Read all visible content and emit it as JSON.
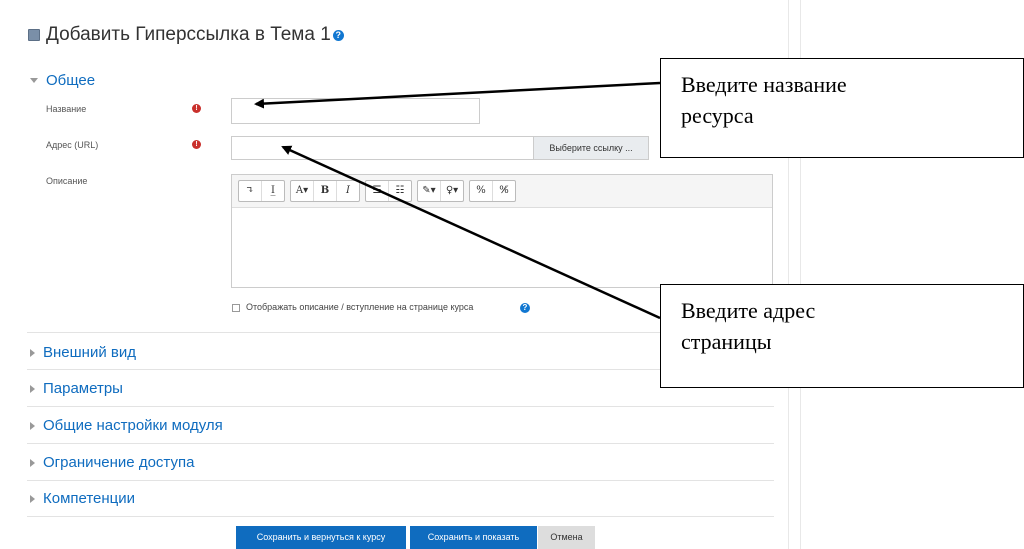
{
  "page": {
    "title": "Добавить Гиперссылка в Тема 1",
    "help_glyph": "?"
  },
  "general_section": {
    "title": "Общее",
    "name_label": "Название",
    "name_value": "",
    "url_label": "Адрес (URL)",
    "url_value": "",
    "choose_link_label": "Выберите ссылку ...",
    "description_label": "Описание",
    "required_glyph": "!",
    "toolbar": {
      "undo": "↴",
      "clear": "I̲",
      "font": "A▾",
      "bold": "B",
      "italic": "I",
      "ul": "☰",
      "ol": "☷",
      "paint": "✎▾",
      "hint": "♀▾",
      "link": "%",
      "unlink": "%̸"
    },
    "description_value": "",
    "show_description_label": "Отображать описание / вступление на странице курса"
  },
  "sections": [
    {
      "title": "Внешний вид"
    },
    {
      "title": "Параметры"
    },
    {
      "title": "Общие настройки модуля"
    },
    {
      "title": "Ограничение доступа"
    },
    {
      "title": "Компетенции"
    }
  ],
  "buttons": {
    "save_return": "Сохранить и вернуться к курсу",
    "save_display": "Сохранить и показать",
    "cancel": "Отмена"
  },
  "callouts": {
    "name_hint_line1": "Введите название",
    "name_hint_line2": "ресурса",
    "url_hint_line1": "Введите адрес",
    "url_hint_line2": "страницы"
  },
  "colors": {
    "accent": "#0f6cbf",
    "required": "#c9302c"
  }
}
